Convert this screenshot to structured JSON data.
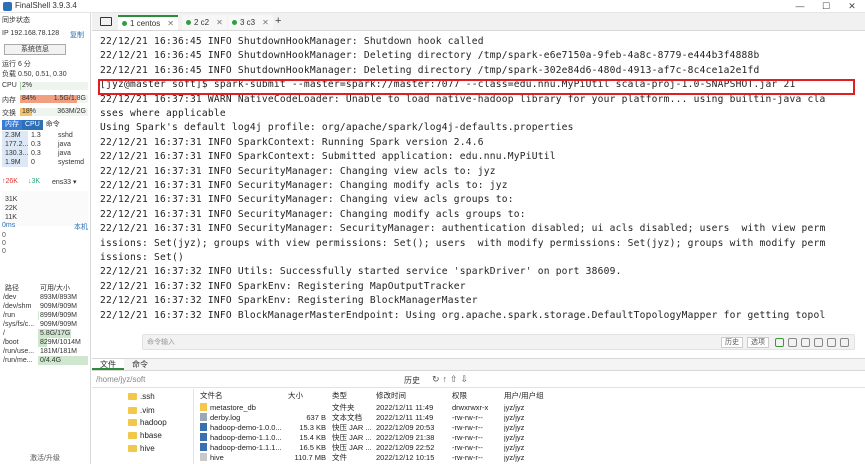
{
  "app": {
    "title": "FinalShell 3.9.3.4"
  },
  "left": {
    "sync_status": "同步状态",
    "ip": "IP 192.168.78.128",
    "copy": "复制",
    "sysinfo_btn": "系统信息",
    "uptime": "运行 6 分",
    "load": "负载 0.50, 0.51, 0.30",
    "cpu": {
      "label": "CPU",
      "value": "2%",
      "fraction": 0.02
    },
    "mem": {
      "label": "内存",
      "value": "84%",
      "detail": "1.5G/1.8G",
      "fraction": 0.84
    },
    "swap": {
      "label": "交换",
      "value": "18%",
      "detail": "363M/2G",
      "fraction": 0.18
    },
    "proc_tabs": [
      "内存",
      "CPU",
      "命令"
    ],
    "processes": [
      {
        "mem": "2.3M",
        "cpu": "1.3",
        "cmd": "sshd"
      },
      {
        "mem": "177.2...",
        "cpu": "0.3",
        "cmd": "java"
      },
      {
        "mem": "130.3...",
        "cpu": "0.3",
        "cmd": "java"
      },
      {
        "mem": "1.9M",
        "cpu": "0",
        "cmd": "systemd"
      }
    ],
    "net": {
      "up": "↑26K",
      "down": "↓3K",
      "iface": "ens33",
      "ticks": [
        "31K",
        "22K",
        "11K"
      ]
    },
    "latency": {
      "value": "0ms",
      "label": "本机",
      "ticks": [
        "0",
        "0",
        "0"
      ]
    },
    "disk_headers": [
      "路径",
      "可用/大小"
    ],
    "disks": [
      {
        "path": "/dev",
        "size": "893M/893M",
        "fraction": 0
      },
      {
        "path": "/dev/shm",
        "size": "909M/909M",
        "fraction": 0
      },
      {
        "path": "/run",
        "size": "899M/909M",
        "fraction": 0.01
      },
      {
        "path": "/sys/fs/c...",
        "size": "909M/909M",
        "fraction": 0
      },
      {
        "path": "/",
        "size": "5.8G/17G",
        "fraction": 0.66
      },
      {
        "path": "/boot",
        "size": "829M/1014M",
        "fraction": 0.18
      },
      {
        "path": "/run/use...",
        "size": "181M/181M",
        "fraction": 0
      },
      {
        "path": "/run/me...",
        "size": "0/4.4G",
        "fraction": 1.0
      }
    ],
    "upgrade": "激活/升级"
  },
  "tabs": [
    {
      "label": "1 centos",
      "active": true
    },
    {
      "label": "2 c2",
      "active": false
    },
    {
      "label": "3 c3",
      "active": false
    }
  ],
  "terminal": {
    "lines": [
      "22/12/21 16:36:45 INFO ShutdownHookManager: Shutdown hook called",
      "22/12/21 16:36:45 INFO ShutdownHookManager: Deleting directory /tmp/spark-e6e7150a-9feb-4a8c-8779-e444b3f4888b",
      "22/12/21 16:36:45 INFO ShutdownHookManager: Deleting directory /tmp/spark-302e84d6-480d-4913-af7c-8c4ce1a2e1fd",
      "[jyz@master soft]$ spark-submit --master=spark://master:7077 --class=edu.nnu.MyPiUtil scala-proj-1.0-SNAPSHOT.jar 21",
      "22/12/21 16:37:31 WARN NativeCodeLoader: Unable to load native-hadoop library for your platform... using builtin-java cla",
      "sses where applicable",
      "Using Spark's default log4j profile: org/apache/spark/log4j-defaults.properties",
      "22/12/21 16:37:31 INFO SparkContext: Running Spark version 2.4.6",
      "22/12/21 16:37:31 INFO SparkContext: Submitted application: edu.nnu.MyPiUtil",
      "22/12/21 16:37:31 INFO SecurityManager: Changing view acls to: jyz",
      "22/12/21 16:37:31 INFO SecurityManager: Changing modify acls to: jyz",
      "22/12/21 16:37:31 INFO SecurityManager: Changing view acls groups to:",
      "22/12/21 16:37:31 INFO SecurityManager: Changing modify acls groups to:",
      "22/12/21 16:37:31 INFO SecurityManager: SecurityManager: authentication disabled; ui acls disabled; users  with view perm",
      "issions: Set(jyz); groups with view permissions: Set(); users  with modify permissions: Set(jyz); groups with modify perm",
      "issions: Set()",
      "22/12/21 16:37:32 INFO Utils: Successfully started service 'sparkDriver' on port 38609.",
      "22/12/21 16:37:32 INFO SparkEnv: Registering MapOutputTracker",
      "22/12/21 16:37:32 INFO SparkEnv: Registering BlockManagerMaster",
      "22/12/21 16:37:32 INFO BlockManagerMasterEndpoint: Using org.apache.spark.storage.DefaultTopologyMapper for getting topol"
    ],
    "cmd_placeholder": "命令输入",
    "cmd_buttons": [
      "历史",
      "选项"
    ]
  },
  "bottom": {
    "tabs": [
      "文件",
      "命令"
    ],
    "path": "/home/jyz/soft",
    "history_btn": "历史",
    "tree": [
      ".ssh",
      ".vim",
      "hadoop",
      "hbase",
      "hive"
    ],
    "headers": [
      "文件名",
      "大小",
      "类型",
      "修改时间",
      "权限",
      "用户/用户组"
    ],
    "files": [
      {
        "name": "metastore_db",
        "size": "",
        "type": "文件夹",
        "mtime": "2022/12/11 11:49",
        "perm": "drwxrwxr-x",
        "owner": "jyz/jyz",
        "kind": "folder"
      },
      {
        "name": "derby.log",
        "size": "637 B",
        "type": "文本文档",
        "mtime": "2022/12/11 11:49",
        "perm": "-rw-rw-r--",
        "owner": "jyz/jyz",
        "kind": "text"
      },
      {
        "name": "hadoop-demo-1.0.0...",
        "size": "15.3 KB",
        "type": "快压 JAR ...",
        "mtime": "2022/12/09 20:53",
        "perm": "-rw-rw-r--",
        "owner": "jyz/jyz",
        "kind": "jar"
      },
      {
        "name": "hadoop-demo-1.1.0...",
        "size": "15.4 KB",
        "type": "快压 JAR ...",
        "mtime": "2022/12/09 21:38",
        "perm": "-rw-rw-r--",
        "owner": "jyz/jyz",
        "kind": "jar"
      },
      {
        "name": "hadoop-demo-1.1.1...",
        "size": "16.5 KB",
        "type": "快压 JAR ...",
        "mtime": "2022/12/09 22:52",
        "perm": "-rw-rw-r--",
        "owner": "jyz/jyz",
        "kind": "jar"
      },
      {
        "name": "hive",
        "size": "110.7 MB",
        "type": "文件",
        "mtime": "2022/12/12 10:15",
        "perm": "-rw-rw-r--",
        "owner": "jyz/jyz",
        "kind": "file"
      }
    ]
  },
  "colors": {
    "accent": "#2d8c3c",
    "highlight": "#e02020",
    "mem_fill": "#f0a080",
    "swap_fill": "#f3c36b",
    "cpu_fill": "#a8d8a8"
  }
}
